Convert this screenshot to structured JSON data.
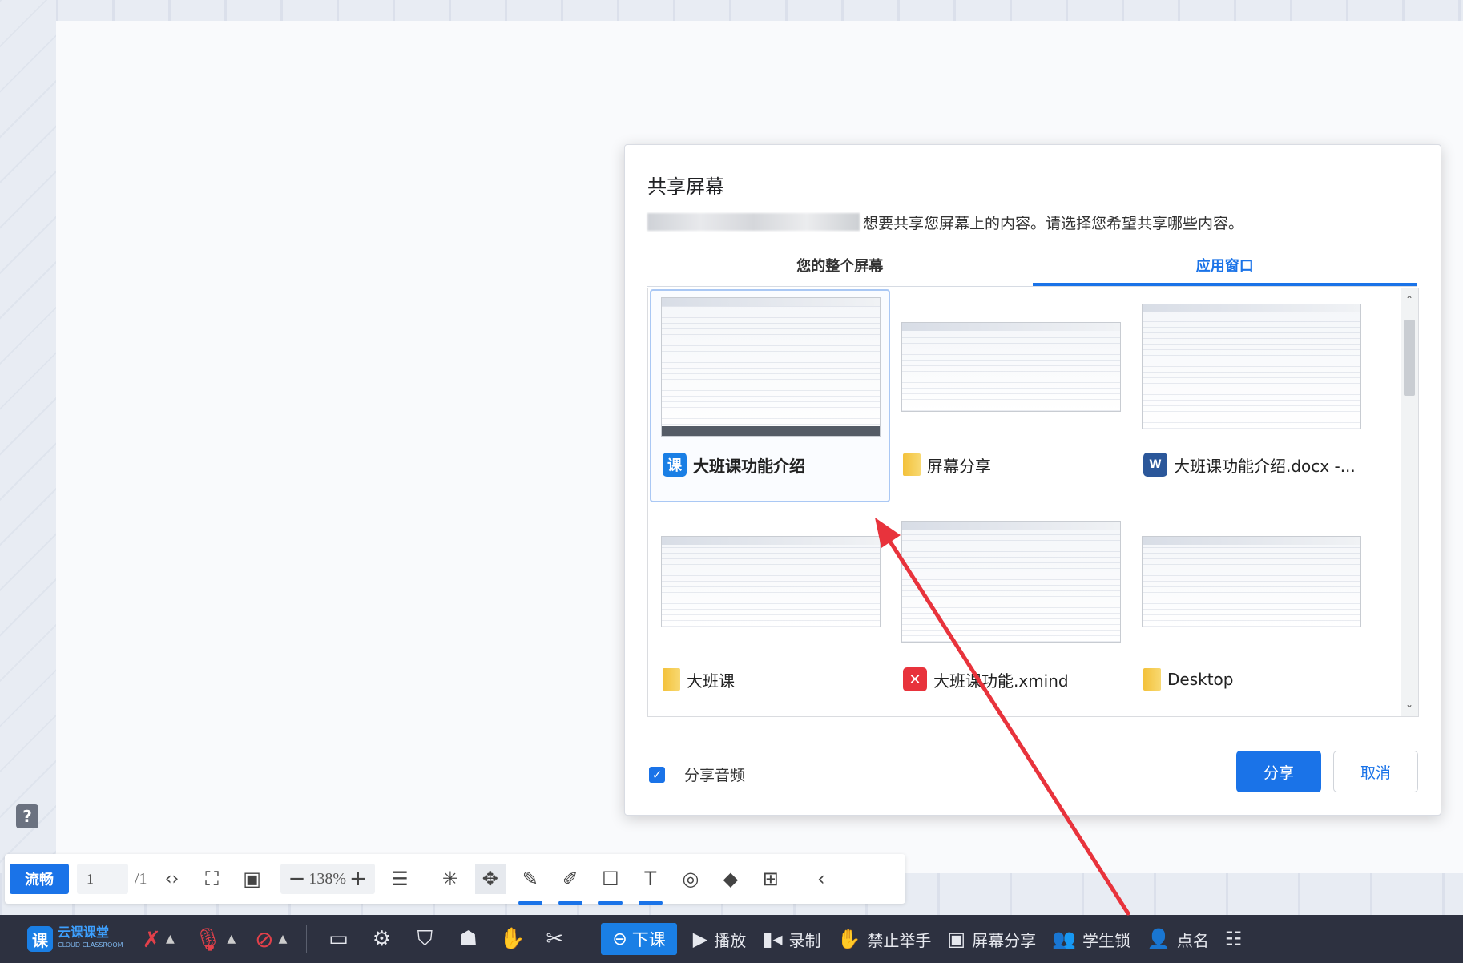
{
  "dialog": {
    "title": "共享屏幕",
    "subtitle": "想要共享您屏幕上的内容。请选择您希望共享哪些内容。",
    "tabs": [
      {
        "label": "您的整个屏幕",
        "active": false
      },
      {
        "label": "应用窗口",
        "active": true
      }
    ],
    "windows": [
      {
        "label": "大班课功能介绍",
        "icon": "ke-app-icon",
        "selected": true
      },
      {
        "label": "屏幕分享",
        "icon": "folder-icon",
        "selected": false
      },
      {
        "label": "大班课功能介绍.docx -...",
        "icon": "word-icon",
        "selected": false
      },
      {
        "label": "大班课",
        "icon": "folder-icon",
        "selected": false
      },
      {
        "label": "大班课功能.xmind",
        "icon": "xmind-icon",
        "selected": false
      },
      {
        "label": "Desktop",
        "icon": "folder-icon",
        "selected": false
      }
    ],
    "share_audio_label": "分享音频",
    "share_audio_checked": true,
    "share_button": "分享",
    "cancel_button": "取消"
  },
  "whiteboard_toolbar": {
    "fluency_label": "流畅",
    "page_current": "1",
    "page_total": "/1",
    "zoom_level": "138%",
    "zoom_minus": "−",
    "zoom_plus": "+"
  },
  "bottom_bar": {
    "brand_name": "云课课堂",
    "brand_sub": "CLOUD CLASSROOM",
    "end_class": "下课",
    "play": "播放",
    "record": "录制",
    "no_raise_hand": "禁止举手",
    "screen_share": "屏幕分享",
    "student_lock": "学生锁",
    "roll_call": "点名"
  },
  "colors": {
    "accent": "#1a73e8",
    "annotation_arrow": "#e8333c",
    "bottom_bar_bg": "#2d3140"
  }
}
